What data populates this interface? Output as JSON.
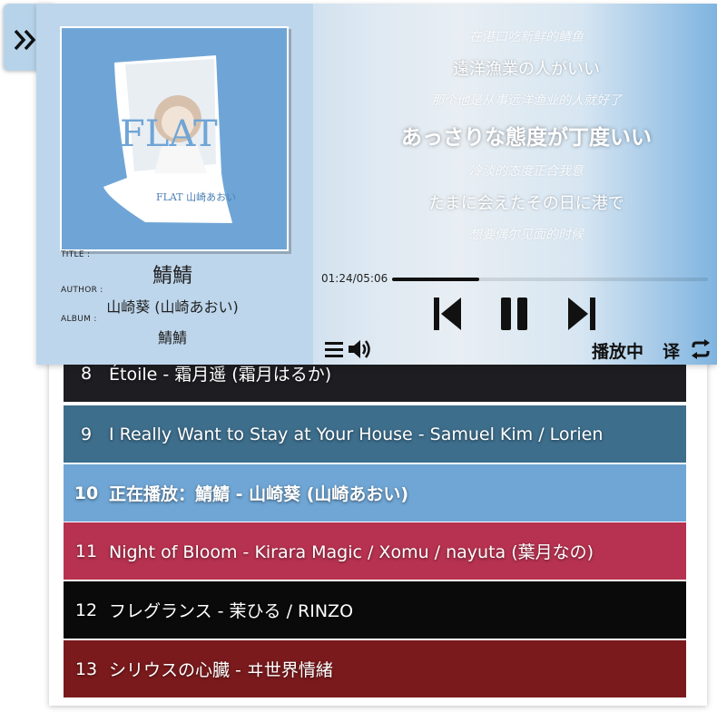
{
  "song": {
    "title_label": "TITLE :",
    "title": "鯖鯖",
    "author_label": "AUTHOR :",
    "author": "山崎葵 (山崎あおい)",
    "album_label": "ALBUM :",
    "album": "鯖鯖"
  },
  "lyrics": [
    {
      "text": "在港口吃新鲜的鲭鱼",
      "style": "small"
    },
    {
      "text": "遠洋漁業の人がいい",
      "style": "med"
    },
    {
      "text": "那个他是从事远洋渔业的人就好了",
      "style": "small"
    },
    {
      "text": "あっさりな態度が丁度いい",
      "style": "active"
    },
    {
      "text": "冷淡的态度正合我意",
      "style": "small"
    },
    {
      "text": "たまに会えたその日に港で",
      "style": "med"
    },
    {
      "text": "想要偶尔见面的时候",
      "style": "small"
    }
  ],
  "playback": {
    "time": "01:24/05:06",
    "progress": 0.275,
    "status": "播放中",
    "translate_label": "译"
  },
  "icons": {
    "collapse": "double-chevron-right-icon",
    "prev": "skip-previous-icon",
    "pause": "pause-icon",
    "next": "skip-next-icon",
    "playlist": "list-icon",
    "volume": "volume-icon",
    "repeat": "repeat-icon"
  },
  "cover_art": {
    "big_letters": "FLAT",
    "small_text": "FLAT 山崎あおい"
  },
  "playlist": [
    {
      "num": "8",
      "title": "Étoile - 霜月遥 (霜月はるか)",
      "bg": "#1e1e22",
      "bold": false
    },
    {
      "num": "9",
      "title": "I Really Want to Stay at Your House - Samuel Kim / Lorien",
      "bg": "#3d6e8c",
      "bold": false
    },
    {
      "num": "10",
      "title": "正在播放：鯖鯖 - 山崎葵 (山崎あおい)",
      "bg": "#6fa6d5",
      "bold": true
    },
    {
      "num": "11",
      "title": "Night of Bloom - Kirara Magic / Xomu / nayuta (葉月なの)",
      "bg": "#b73250",
      "bold": false
    },
    {
      "num": "12",
      "title": "フレグランス - 茉ひる / RINZO",
      "bg": "#0a0a0a",
      "bold": false
    },
    {
      "num": "13",
      "title": "シリウスの心臓 - ヰ世界情緒",
      "bg": "#7a1a1c",
      "bold": false
    }
  ]
}
